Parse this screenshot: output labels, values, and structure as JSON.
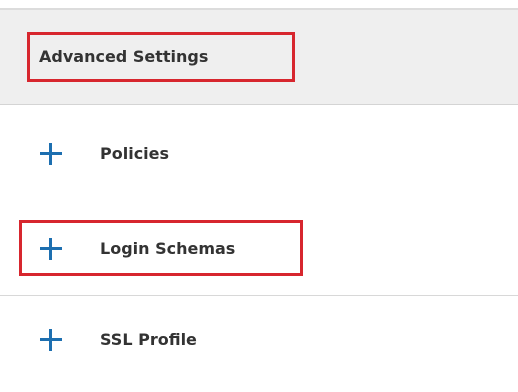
{
  "section": {
    "title": "Advanced Settings"
  },
  "items": [
    {
      "label": "Policies",
      "icon": "plus-icon"
    },
    {
      "label": "Login Schemas",
      "icon": "plus-icon"
    },
    {
      "label": "SSL Profile",
      "icon": "plus-icon"
    }
  ],
  "colors": {
    "accent": "#1d6fb0",
    "highlight": "#d7262e",
    "header_bg": "#efefef",
    "text": "#333333"
  }
}
